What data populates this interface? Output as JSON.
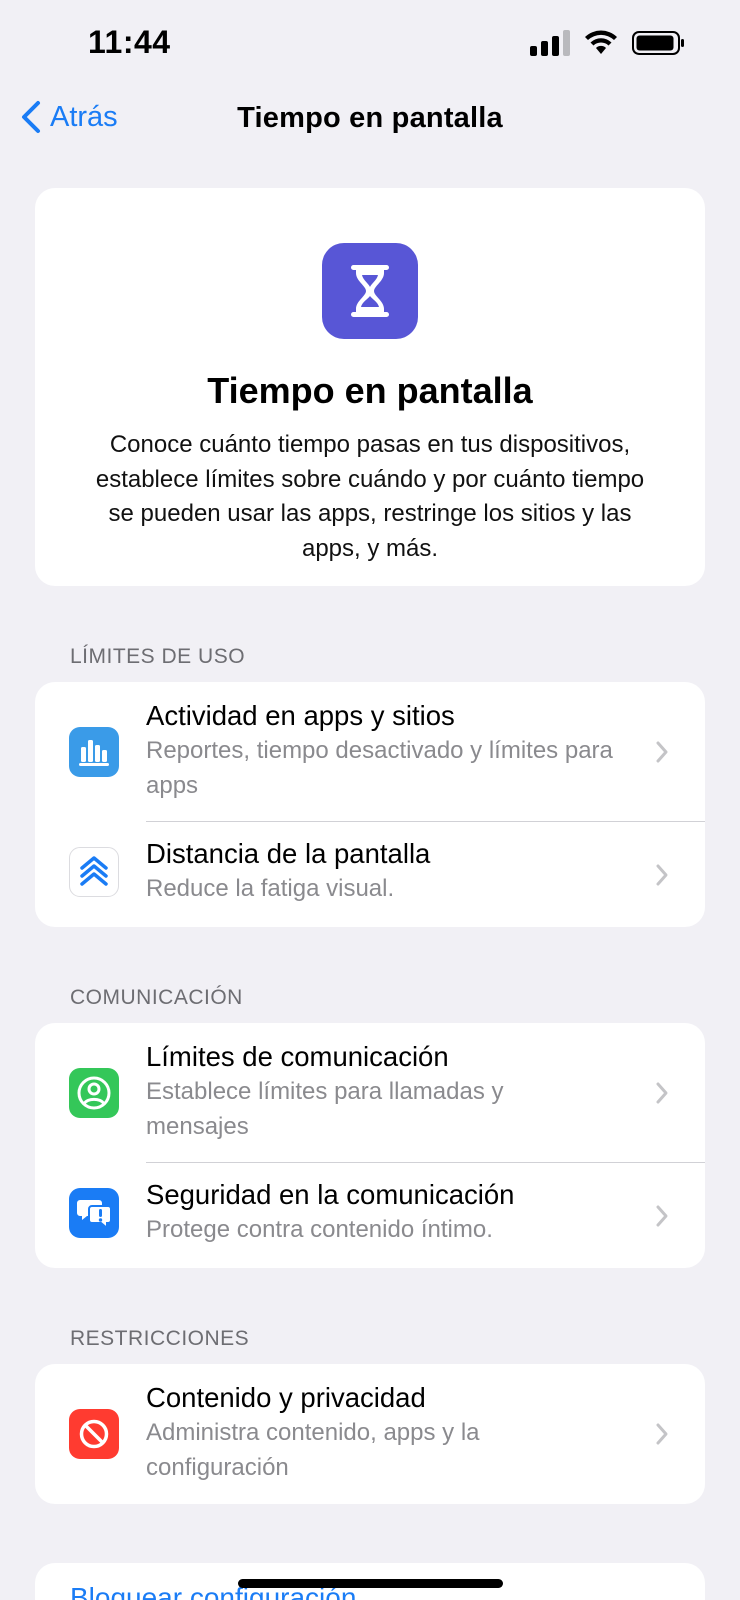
{
  "status_bar": {
    "time": "11:44"
  },
  "nav": {
    "back_label": "Atrás",
    "title": "Tiempo en pantalla"
  },
  "hero": {
    "icon": "hourglass-icon",
    "icon_color": "#5856d6",
    "title": "Tiempo en pantalla",
    "description": "Conoce cuánto tiempo pasas en tus dispositivos, establece límites sobre cuándo y por cuánto tiempo se pueden usar las apps, restringe los sitios y las apps, y más."
  },
  "sections": [
    {
      "header": "LÍMITES DE USO",
      "items": [
        {
          "title": "Actividad en apps y sitios",
          "subtitle": "Reportes, tiempo desactivado y límites para apps",
          "icon": "bar-chart-icon",
          "icon_color": "#3a9be8"
        },
        {
          "title": "Distancia de la pantalla",
          "subtitle": "Reduce la fatiga visual.",
          "icon": "chevrons-up-icon",
          "icon_color": "#ffffff"
        }
      ]
    },
    {
      "header": "COMUNICACIÓN",
      "items": [
        {
          "title": "Límites de comunicación",
          "subtitle": "Establece límites para llamadas y mensajes",
          "icon": "person-circle-icon",
          "icon_color": "#34c759"
        },
        {
          "title": "Seguridad en la comunicación",
          "subtitle": "Protege contra contenido íntimo.",
          "icon": "message-warning-icon",
          "icon_color": "#1a7cf5"
        }
      ]
    },
    {
      "header": "RESTRICCIONES",
      "items": [
        {
          "title": "Contenido y privacidad",
          "subtitle": "Administra contenido, apps y la configuración",
          "icon": "no-entry-icon",
          "icon_color": "#ff3b30"
        }
      ]
    }
  ],
  "footer": {
    "lock_label": "Bloquear configuración"
  },
  "colors": {
    "accent": "#1a7cf5",
    "background": "#f1f0f5"
  }
}
